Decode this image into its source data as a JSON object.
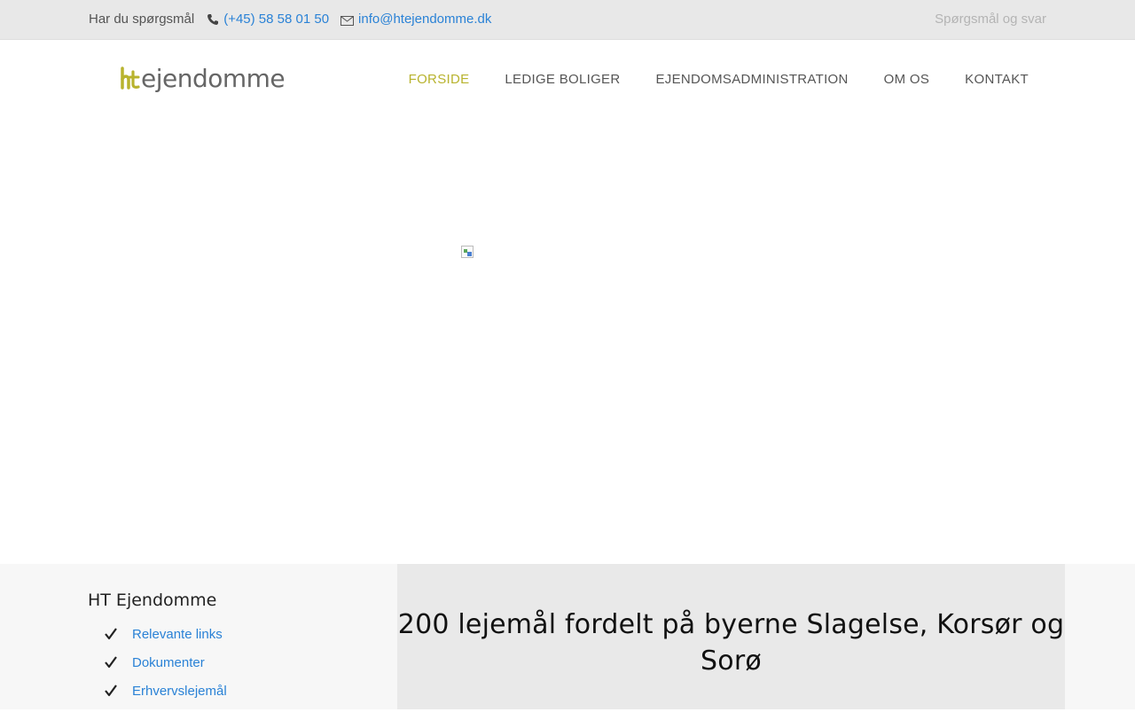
{
  "topbar": {
    "question": "Har du spørgsmål",
    "phone": "(+45) 58 58 01 50",
    "email": "info@htejendomme.dk",
    "faq": "Spørgsmål og svar"
  },
  "logo": {
    "mark": "ht",
    "word": "ejendomme"
  },
  "nav": {
    "items": [
      {
        "label": "FORSIDE",
        "active": true
      },
      {
        "label": "LEDIGE BOLIGER",
        "active": false
      },
      {
        "label": "EJENDOMSADMINISTRATION",
        "active": false
      },
      {
        "label": "OM OS",
        "active": false
      },
      {
        "label": "KONTAKT",
        "active": false
      }
    ]
  },
  "sidebar": {
    "title": "HT Ejendomme",
    "links": [
      {
        "label": "Relevante links"
      },
      {
        "label": "Dokumenter"
      },
      {
        "label": "Erhvervslejemål"
      }
    ]
  },
  "feature": {
    "heading": "200 lejemål fordelt på byerne Slagelse, Korsør og Sorø"
  },
  "colors": {
    "accent": "#b8b32e",
    "link": "#2a82d6",
    "topbar_bg": "#e8e8e8",
    "feature_bg": "#e9e9e9"
  },
  "icons": [
    "phone-icon",
    "mail-icon",
    "check-icon",
    "broken-image-icon"
  ]
}
